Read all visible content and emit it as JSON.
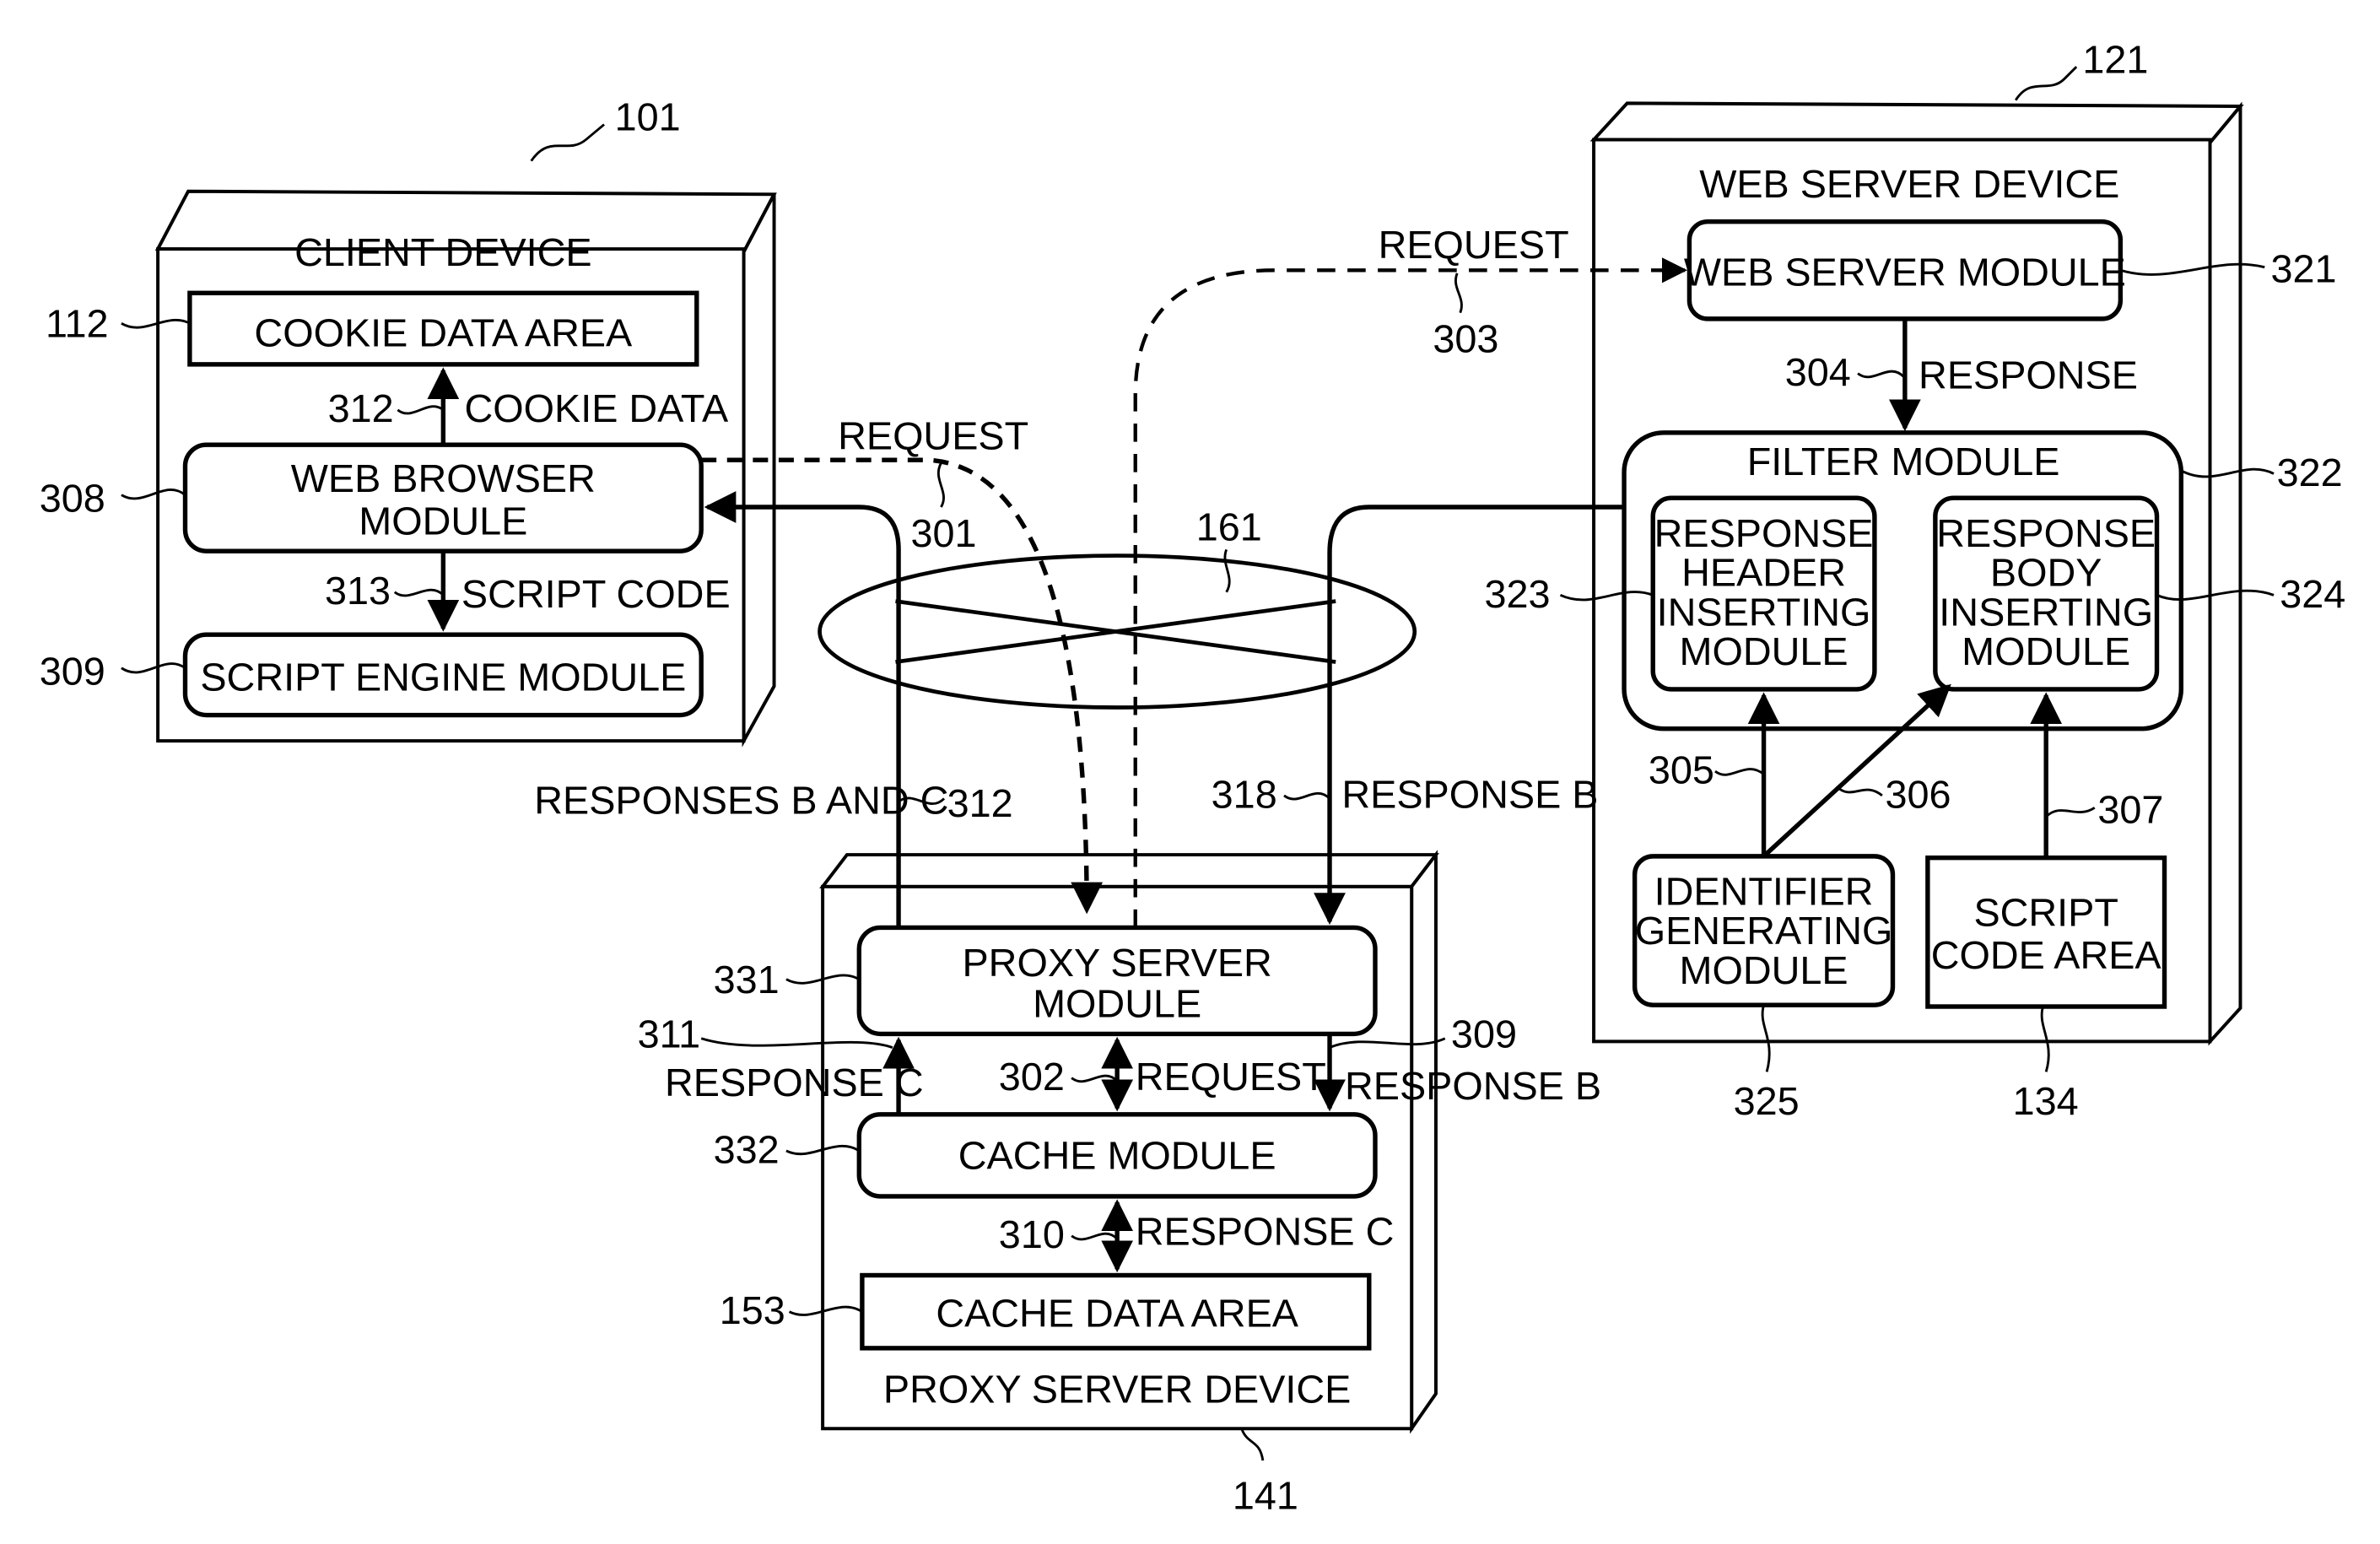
{
  "devices": {
    "client": {
      "title": "CLIENT DEVICE",
      "ref": "101"
    },
    "web_server": {
      "title": "WEB SERVER DEVICE",
      "ref": "121"
    },
    "proxy": {
      "title": "PROXY SERVER DEVICE",
      "ref": "141"
    },
    "network": {
      "ref": "161"
    }
  },
  "client_modules": {
    "cookie_area": {
      "label": "COOKIE DATA AREA",
      "ref": "112"
    },
    "browser": {
      "label_line1": "WEB BROWSER",
      "label_line2": "MODULE",
      "ref": "308"
    },
    "script_engine": {
      "label": "SCRIPT ENGINE MODULE",
      "ref": "309"
    }
  },
  "web_modules": {
    "web_server_module": {
      "label": "WEB SERVER MODULE",
      "ref": "321"
    },
    "filter": {
      "label": "FILTER MODULE",
      "ref": "322"
    },
    "header_inserting": {
      "lines": [
        "RESPONSE",
        "HEADER",
        "INSERTING",
        "MODULE"
      ],
      "ref": "323"
    },
    "body_inserting": {
      "lines": [
        "RESPONSE",
        "BODY",
        "INSERTING",
        "MODULE"
      ],
      "ref": "324"
    },
    "identifier": {
      "lines": [
        "IDENTIFIER",
        "GENERATING",
        "MODULE"
      ],
      "ref": "325"
    },
    "script_code_area": {
      "lines": [
        "SCRIPT",
        "CODE AREA"
      ],
      "ref": "134"
    }
  },
  "proxy_modules": {
    "proxy_server_module": {
      "label_line1": "PROXY SERVER",
      "label_line2": "MODULE",
      "ref": "331"
    },
    "cache_module": {
      "label": "CACHE MODULE",
      "ref": "332"
    },
    "cache_data_area": {
      "label": "CACHE DATA AREA",
      "ref": "153"
    }
  },
  "flows": {
    "cookie_data": {
      "label": "COOKIE DATA",
      "ref": "312"
    },
    "script_code": {
      "label": "SCRIPT CODE",
      "ref": "313"
    },
    "request_301": {
      "label": "REQUEST",
      "ref": "301"
    },
    "request_303": {
      "label": "REQUEST",
      "ref": "303"
    },
    "response_304": {
      "label": "RESPONSE",
      "ref": "304"
    },
    "flow_305": {
      "ref": "305"
    },
    "flow_306": {
      "ref": "306"
    },
    "flow_307": {
      "ref": "307"
    },
    "responses_b_c": {
      "label": "RESPONSES B AND C",
      "ref": "312"
    },
    "response_b_318": {
      "label": "RESPONSE B",
      "ref": "318"
    },
    "response_c_311": {
      "label": "RESPONSE C",
      "ref": "311"
    },
    "request_302": {
      "label": "REQUEST",
      "ref": "302"
    },
    "response_b_309": {
      "label": "RESPONSE B",
      "ref": "309"
    },
    "response_c_310": {
      "label": "RESPONSE C",
      "ref": "310"
    }
  }
}
